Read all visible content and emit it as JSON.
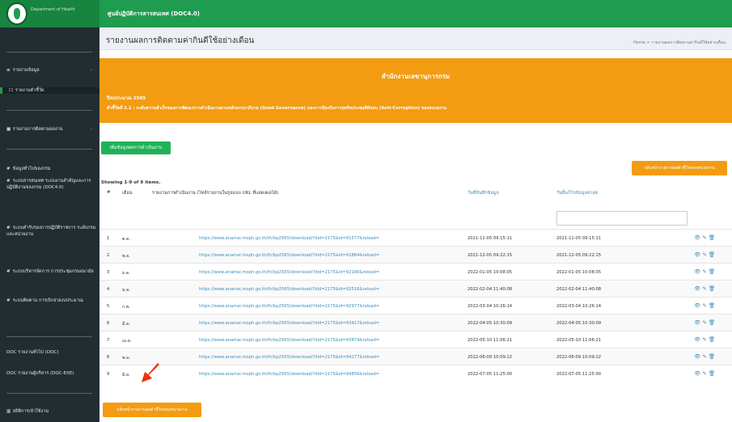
{
  "header": {
    "logo_text": "Department of Health",
    "title": "ศูนย์ปฏิบัติการสารสนเทศ (DOC4.0)"
  },
  "sidebar": {
    "items": [
      {
        "icon": "≡",
        "label": "รายงานข้อมูล"
      },
      {
        "icon": "☐",
        "label": "รายงานตัวชี้วัด"
      },
      {
        "icon": "▦",
        "label": "รายงานการติดตามผลงาน"
      },
      {
        "icon": "#",
        "label": "ข้อมูลทั่วไปของกรม"
      },
      {
        "icon": "#",
        "label": "ระบบสารสนเทศ ระบบงานสำคัญและการปฏิบัติงานของกรม (DOC4.0)"
      },
      {
        "icon": "#",
        "label": "ระบบคำรับรองการปฏิบัติราชการ ระดับกรมและหน่วยงาน"
      },
      {
        "icon": "#",
        "label": "ระบบบริหารจัดการ การประชุมกรมอนามัย"
      },
      {
        "icon": "#",
        "label": "ระบบติดตาม การเบิกจ่ายงบประมาณ"
      },
      {
        "icon": "",
        "label": "DOC รายงานทั่วไป (DOC)"
      },
      {
        "icon": "",
        "label": "DOC รายงานผู้บริหาร (DOC-EXE)"
      },
      {
        "icon": "▥",
        "label": "สถิติการเข้าใช้งาน"
      }
    ]
  },
  "page": {
    "title": "รายงานผลการติดตามค่ากินดีใช้อย่างเดือน",
    "breadcrumb": "Home > รายงานผลการติดตามค่ากินดีใช้อย่างเดือน"
  },
  "banner": {
    "title": "สำนักงานเลขานุการกรม",
    "line1": "ปีงบประมาณ 2565",
    "line2": "ตัวชี้วัดที่ 2.1 : ระดับความสำเร็จของการพัฒนาการดำเนินงานตามหลักธรรมาภิบาล (Good Governance) และการป้องกันการทุจริตประพฤติมิชอบ (Anti-Corruption) ของหน่วยงาน"
  },
  "buttons": {
    "add_report": "เพิ่มข้อมูลผลการดำเนินงาน",
    "back_right": "กลับหน้ารายงานผลตัวชี้วัดของหน่วยงาน",
    "back_bottom": "กลับหน้ารายงานผลตัวชี้วัดของหน่วยงาน"
  },
  "table": {
    "summary": "Showing 1-9 of 9 items.",
    "columns": {
      "num": "#",
      "month": "เดือน",
      "url": "รายงานการดำเนินงาน (ไฟล์รายงานในรูปแบบ URL ที่แสดงผลได้)",
      "created": "วันที่บันทึกข้อมูล",
      "updated": "วันที่แก้ไขข้อมูลล่าสุด"
    },
    "rows": [
      {
        "num": "1",
        "month": "ต.ค.",
        "url": "https://www.anamai.moph.go.th/th/bp2565/download/?did=2175&id=91577&reload=",
        "created": "2021-11-05 09:15:11",
        "updated": "2021-11-05 09:15:11",
        "actions": "👁 ✎ 🗑"
      },
      {
        "num": "2",
        "month": "พ.ย.",
        "url": "https://www.anamai.moph.go.th/th/bp2565/download/?did=2175&id=91884&reload=",
        "created": "2021-12-05 09:22:15",
        "updated": "2021-12-05 09:22:15",
        "actions": "👁 ✎ 🗑"
      },
      {
        "num": "3",
        "month": "ธ.ค.",
        "url": "https://www.anamai.moph.go.th/th/bp2565/download/?did=2175&id=92190&reload=",
        "created": "2022-01-05 10:08:05",
        "updated": "2022-01-05 10:08:05",
        "actions": "👁 ✎ 🗑"
      },
      {
        "num": "4",
        "month": "ม.ค.",
        "url": "https://www.anamai.moph.go.th/th/bp2565/download/?did=2175&id=92516&reload=",
        "created": "2022-02-04 11:40:08",
        "updated": "2022-02-04 11:40:08",
        "actions": "👁 ✎ 🗑"
      },
      {
        "num": "5",
        "month": "ก.พ.",
        "url": "https://www.anamai.moph.go.th/th/bp2565/download/?did=2175&id=92977&reload=",
        "created": "2022-03-04 10:26:14",
        "updated": "2022-03-04 10:26:14",
        "actions": "👁 ✎ 🗑"
      },
      {
        "num": "6",
        "month": "มี.ค.",
        "url": "https://www.anamai.moph.go.th/th/bp2565/download/?did=2175&id=93417&reload=",
        "created": "2022-04-05 10:30:09",
        "updated": "2022-04-05 10:30:09",
        "actions": "👁 ✎ 🗑"
      },
      {
        "num": "7",
        "month": "เม.ย.",
        "url": "https://www.anamai.moph.go.th/th/bp2565/download/?did=2175&id=93874&reload=",
        "created": "2022-05-10 11:06:21",
        "updated": "2022-05-10 11:06:21",
        "actions": "👁 ✎ 🗑"
      },
      {
        "num": "8",
        "month": "พ.ค.",
        "url": "https://www.anamai.moph.go.th/th/bp2565/download/?did=2175&id=94277&reload=",
        "created": "2022-06-09 10:09:22",
        "updated": "2022-06-09 10:09:22",
        "actions": "👁 ✎ 🗑"
      },
      {
        "num": "9",
        "month": "มิ.ย.",
        "url": "https://www.anamai.moph.go.th/th/bp2565/download/?did=2175&id=94856&reload=",
        "created": "2022-07-05 11:25:00",
        "updated": "2022-07-05 11:25:00",
        "actions": "👁 ✎ 🗑"
      }
    ]
  },
  "colors": {
    "topbar": "#1f9c4f",
    "sidebar": "#222d32",
    "banner": "#f39c12",
    "link": "#3c8dbc",
    "annotation_arrow": "#e8360e"
  }
}
